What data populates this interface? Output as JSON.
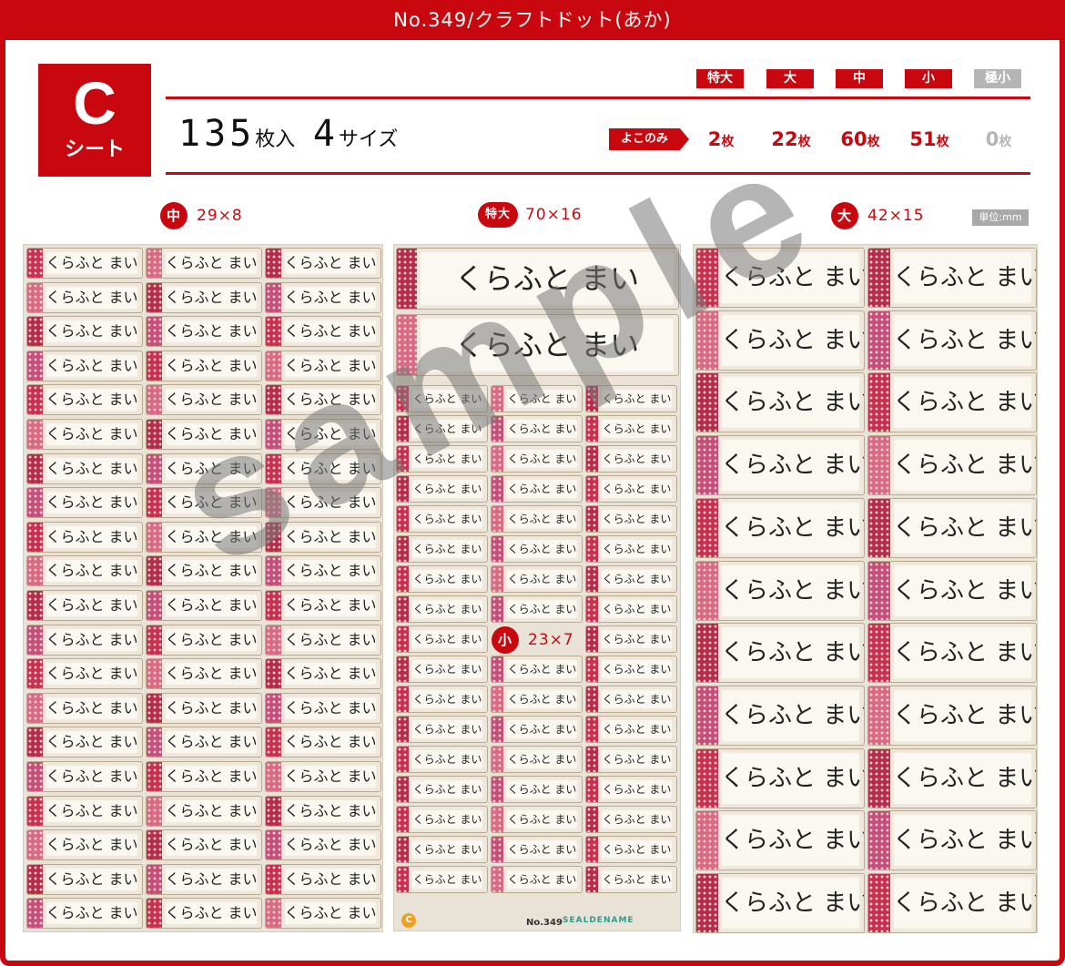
{
  "header": {
    "title": "No.349/クラフトドット(あか)"
  },
  "sheet_badge": {
    "letter": "C",
    "label": "シート"
  },
  "summary": {
    "count": "135",
    "count_unit": "枚入",
    "sizes": "4",
    "sizes_unit": "サイズ"
  },
  "size_tags": [
    {
      "label": "特大",
      "count": "2",
      "unit": "枚",
      "color": "#c8080e"
    },
    {
      "label": "大",
      "count": "22",
      "unit": "枚",
      "color": "#c8080e"
    },
    {
      "label": "中",
      "count": "60",
      "unit": "枚",
      "color": "#c8080e"
    },
    {
      "label": "小",
      "count": "51",
      "unit": "枚",
      "color": "#c8080e"
    },
    {
      "label": "極小",
      "count": "0",
      "unit": "枚",
      "color": "#b5b5b5"
    }
  ],
  "yoko_label": "よこのみ",
  "sections": {
    "medium": {
      "badge": "中",
      "dims": "29×8"
    },
    "xlarge": {
      "badge": "特大",
      "dims": "70×16"
    },
    "large": {
      "badge": "大",
      "dims": "42×15"
    },
    "small": {
      "badge": "小",
      "dims": "23×7"
    }
  },
  "unit_label": "単位:mm",
  "label_text": "くらふと まい",
  "watermark": "sample",
  "footer": {
    "sheet_letter": "C",
    "code": "No.349",
    "brand": "SEALDENAME"
  },
  "colors": {
    "accent": "#c8080e",
    "dot_pink": "#c9304e",
    "kraft": "#efe7d9"
  }
}
